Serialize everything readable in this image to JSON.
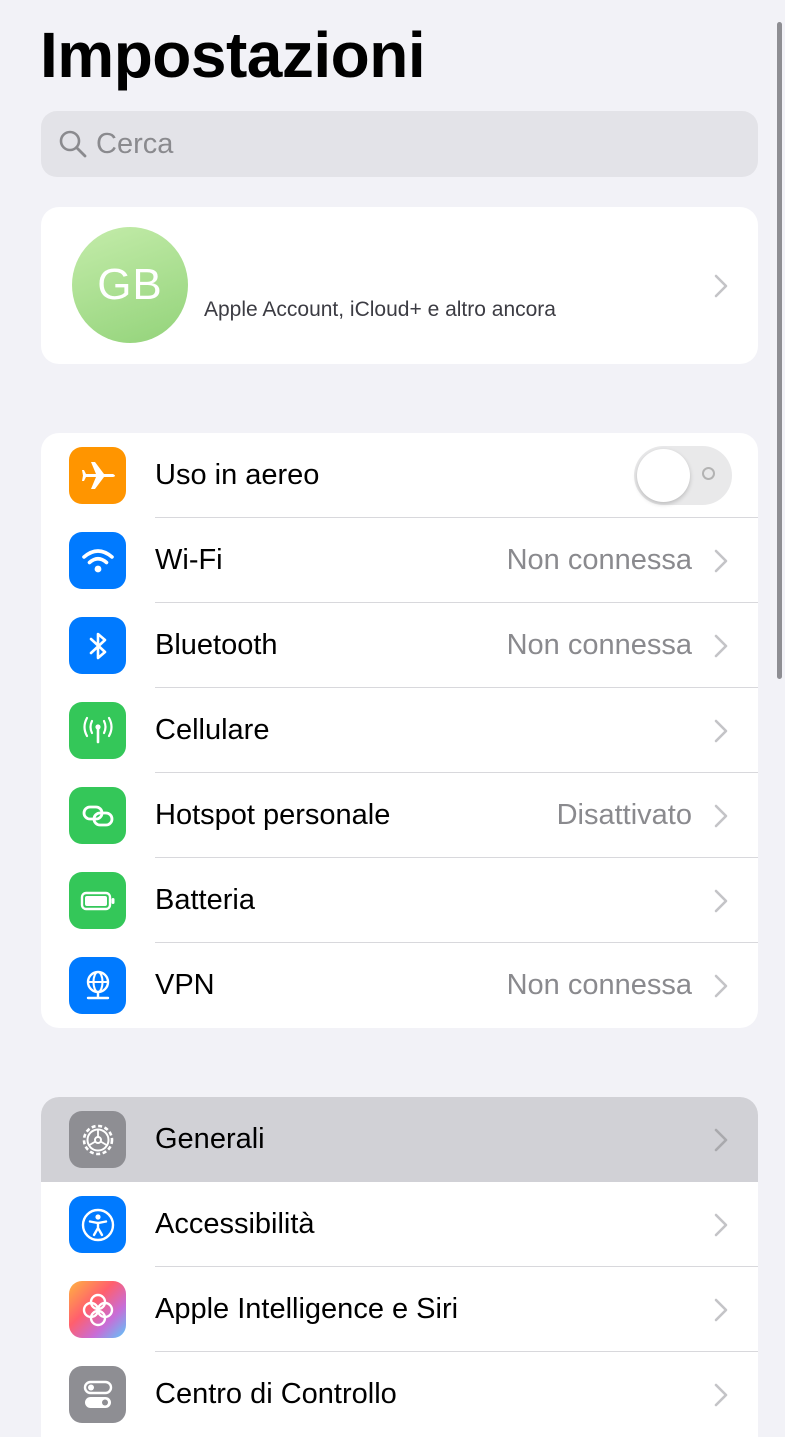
{
  "header": {
    "title": "Impostazioni"
  },
  "search": {
    "placeholder": "Cerca",
    "icon": "magnifying-glass"
  },
  "profile": {
    "initials": "GB",
    "subtitle": "Apple Account, iCloud+ e altro ancora"
  },
  "network_section": {
    "rows": [
      {
        "label": "Uso in aereo",
        "icon": "airplane",
        "color": "#ff9500",
        "toggle": false
      },
      {
        "label": "Wi-Fi",
        "value": "Non connessa",
        "icon": "wifi",
        "color": "#007aff"
      },
      {
        "label": "Bluetooth",
        "value": "Non connessa",
        "icon": "bluetooth",
        "color": "#007aff"
      },
      {
        "label": "Cellulare",
        "value": "",
        "icon": "antenna",
        "color": "#34c759"
      },
      {
        "label": "Hotspot personale",
        "value": "Disattivato",
        "icon": "link",
        "color": "#34c759"
      },
      {
        "label": "Batteria",
        "value": "",
        "icon": "battery",
        "color": "#34c759"
      },
      {
        "label": "VPN",
        "value": "Non connessa",
        "icon": "globe",
        "color": "#007aff"
      }
    ]
  },
  "general_section": {
    "rows": [
      {
        "label": "Generali",
        "icon": "gear",
        "color": "#8e8e93",
        "selected": true
      },
      {
        "label": "Accessibilità",
        "icon": "accessibility",
        "color": "#007aff"
      },
      {
        "label": "Apple Intelligence e Siri",
        "icon": "apple-intelligence",
        "color": "#ff6f5e"
      },
      {
        "label": "Centro di Controllo",
        "icon": "switches",
        "color": "#8e8e93"
      }
    ]
  }
}
